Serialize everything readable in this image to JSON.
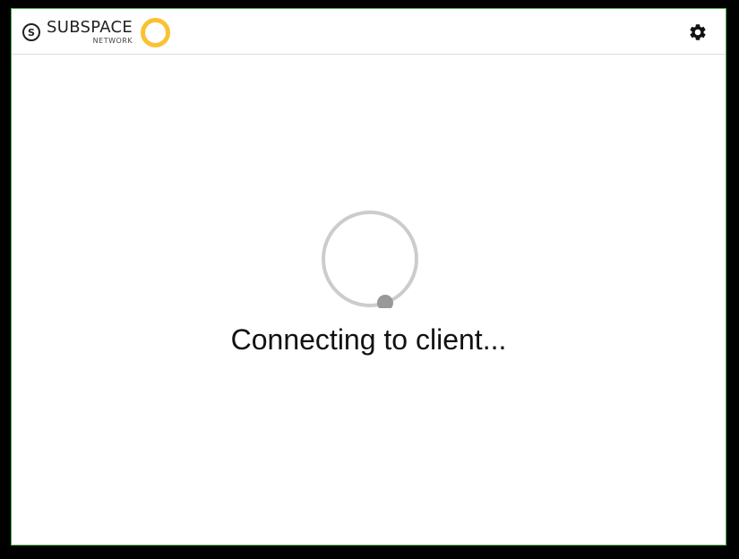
{
  "header": {
    "logo_main": "SUBSPACE",
    "logo_sub": "NETWORK",
    "logo_mark": "S",
    "icons": {
      "settings": "gear-icon"
    }
  },
  "main": {
    "status_text": "Connecting to client..."
  },
  "colors": {
    "brand_ring": "#f9c232",
    "spinner_track": "#cccccc",
    "spinner_dot": "#999999",
    "window_border": "#4caf50"
  }
}
